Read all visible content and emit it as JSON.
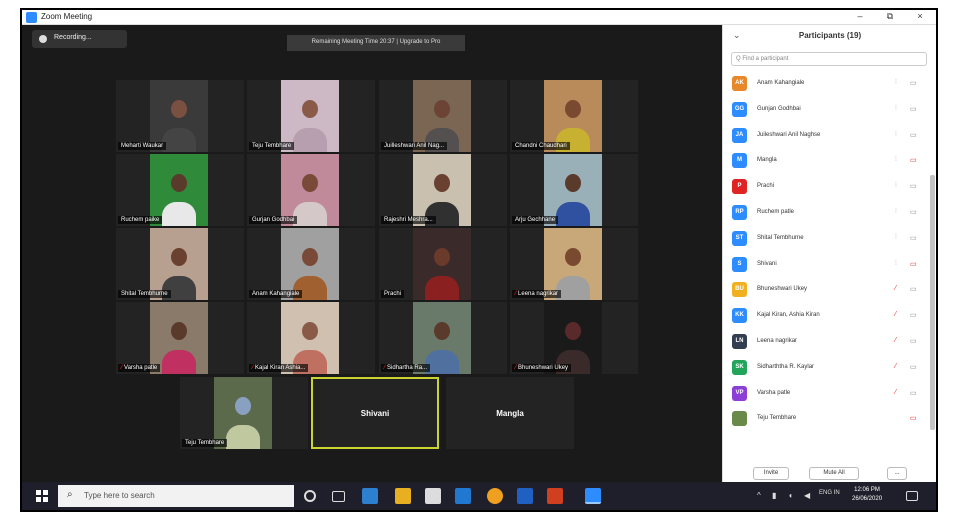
{
  "window": {
    "title": "Zoom Meeting",
    "minimize": "–",
    "maximize": "⧉",
    "close": "×"
  },
  "meeting": {
    "recording_label": "Recording...",
    "banner_text": "Remaining Meeting Time 20:37 | Upgrade to Pro",
    "tiles": [
      {
        "name": "Meharti Waukar",
        "muted": false,
        "bg": "#3a3a3a",
        "skin": "#7a5040",
        "shirt": "#444444"
      },
      {
        "name": "Teju Tembhare",
        "muted": false,
        "bg": "#cdb9c6",
        "skin": "#8a5a48",
        "shirt": "#b89fb0"
      },
      {
        "name": "Juilleshwari Anil Nag...",
        "muted": false,
        "bg": "#7a6652",
        "skin": "#6b4435",
        "shirt": "#555050"
      },
      {
        "name": "Chandni Chaudhari",
        "muted": false,
        "bg": "#b98a5a",
        "skin": "#7a4a30",
        "shirt": "#c8b030"
      },
      {
        "name": "Ruchem paike",
        "muted": false,
        "bg": "#2f8a3a",
        "skin": "#5a3a2a",
        "shirt": "#e8e8e8"
      },
      {
        "name": "Gurjan Godhbai",
        "muted": false,
        "bg": "#c08a9a",
        "skin": "#7a4a38",
        "shirt": "#d4c8c8"
      },
      {
        "name": "Rajeshri Meshra...",
        "muted": false,
        "bg": "#c9c0b0",
        "skin": "#6a4030",
        "shirt": "#303030"
      },
      {
        "name": "Arju Gechhane",
        "muted": false,
        "bg": "#9ab0b8",
        "skin": "#5a3a2a",
        "shirt": "#3050a0"
      },
      {
        "name": "Shital Tembhurne",
        "muted": false,
        "bg": "#b8a090",
        "skin": "#6a4030",
        "shirt": "#404040"
      },
      {
        "name": "Anam Kahangiale",
        "muted": false,
        "bg": "#a0a0a0",
        "skin": "#7a4a38",
        "shirt": "#a06030"
      },
      {
        "name": "Prachi",
        "muted": false,
        "bg": "#3a2a2a",
        "skin": "#6a3a2a",
        "shirt": "#8a2020"
      },
      {
        "name": "Leena nagrikar",
        "muted": true,
        "bg": "#c8a878",
        "skin": "#7a4a30",
        "shirt": "#a0a0a0"
      },
      {
        "name": "Varsha patle",
        "muted": true,
        "bg": "#8a7a6a",
        "skin": "#5a3a2a",
        "shirt": "#c03060"
      },
      {
        "name": "Kajal Kiran Ashia...",
        "muted": true,
        "bg": "#d0c0b0",
        "skin": "#8a5a48",
        "shirt": "#c07060"
      },
      {
        "name": "Sidhartha Ra...",
        "muted": true,
        "bg": "#6a7a6a",
        "skin": "#5a3a2a",
        "shirt": "#5070a0"
      },
      {
        "name": "Bhuneshwari Ukey",
        "muted": true,
        "bg": "#1a1a1a",
        "skin": "#5a2a2a",
        "shirt": "#3a2a2a"
      },
      {
        "name": "Teju Tembhare",
        "muted": false,
        "bg": "#5a6a4a",
        "skin": "#8aa0c0",
        "shirt": "#c0c8a0"
      }
    ],
    "name_tiles": [
      {
        "name": "Shivani"
      },
      {
        "name": "Mangla"
      }
    ]
  },
  "participants": {
    "title": "Participants (19)",
    "collapse_icon": "⌄",
    "search_placeholder": "Q Find a participant",
    "list": [
      {
        "initials": "AK",
        "name": "Anam Kahangiale",
        "color": "#e8862a",
        "muted": false,
        "cam_off": false
      },
      {
        "initials": "GG",
        "name": "Gunjan Godhbai",
        "color": "#2d8cff",
        "muted": false,
        "cam_off": false
      },
      {
        "initials": "JA",
        "name": "Juileshwari Anil Naghse",
        "color": "#2d8cff",
        "muted": false,
        "cam_off": false
      },
      {
        "initials": "M",
        "name": "Mangla",
        "color": "#2d8cff",
        "muted": false,
        "cam_off": true
      },
      {
        "initials": "P",
        "name": "Prachi",
        "color": "#e02424",
        "muted": false,
        "cam_off": false
      },
      {
        "initials": "RP",
        "name": "Ruchem patle",
        "color": "#2d8cff",
        "muted": false,
        "cam_off": false
      },
      {
        "initials": "ST",
        "name": "Shital Tembhurne",
        "color": "#2d8cff",
        "muted": false,
        "cam_off": false
      },
      {
        "initials": "S",
        "name": "Shivani",
        "color": "#2d8cff",
        "muted": false,
        "cam_off": true
      },
      {
        "initials": "BU",
        "name": "Bhuneshwari Ukey",
        "color": "#f0b020",
        "muted": true,
        "cam_off": false
      },
      {
        "initials": "KK",
        "name": "Kajal Kiran, Ashia Kiran",
        "color": "#2d8cff",
        "muted": true,
        "cam_off": false
      },
      {
        "initials": "LN",
        "name": "Leena nagrikar",
        "color": "#333f50",
        "muted": true,
        "cam_off": false
      },
      {
        "initials": "SK",
        "name": "Sidharththa R. Kaylar",
        "color": "#22a55a",
        "muted": true,
        "cam_off": false
      },
      {
        "initials": "VP",
        "name": "Varsha patle",
        "color": "#8c3fd6",
        "muted": true,
        "cam_off": false
      },
      {
        "initials": "",
        "name": "Teju Tembhare",
        "color": "#6a8a4a",
        "muted": false,
        "cam_off": true
      }
    ],
    "invite_label": "Invite",
    "mute_all_label": "Mute All",
    "more_label": "..."
  },
  "taskbar": {
    "search_placeholder": "Type here to search",
    "time": "12:06 PM",
    "date": "26/06/2020",
    "lang": "ENG IN"
  }
}
